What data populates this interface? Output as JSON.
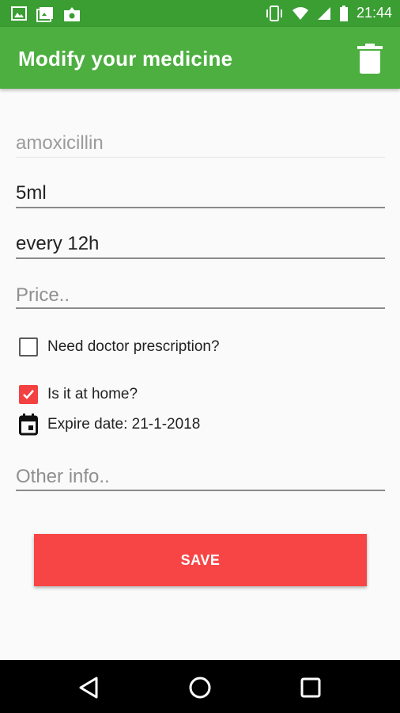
{
  "status_bar": {
    "time": "21:44",
    "left_icons": [
      "gallery-icon",
      "image-icon",
      "photo-upload-icon"
    ],
    "right_icons": [
      "vibrate-icon",
      "wifi-icon",
      "signal-icon",
      "battery-icon"
    ]
  },
  "app_bar": {
    "title": "Modify your medicine",
    "action_icon": "trash-icon"
  },
  "form": {
    "name": {
      "value": "amoxicillin"
    },
    "dose": {
      "value": "5ml"
    },
    "frequency": {
      "value": "every 12h"
    },
    "price": {
      "placeholder": "Price..",
      "value": ""
    },
    "prescription": {
      "label": "Need doctor prescription?",
      "checked": false
    },
    "at_home": {
      "label": "Is it at home?",
      "checked": true
    },
    "expire": {
      "label": "Expire date: 21-1-2018",
      "icon": "calendar-icon"
    },
    "other_info": {
      "placeholder": "Other info..",
      "value": ""
    },
    "save_label": "SAVE"
  },
  "colors": {
    "status_bar": "#3a9e33",
    "app_bar": "#4caf3f",
    "accent": "#f74545"
  },
  "nav_bar": {
    "icons": [
      "back-icon",
      "home-icon",
      "recents-icon"
    ]
  }
}
